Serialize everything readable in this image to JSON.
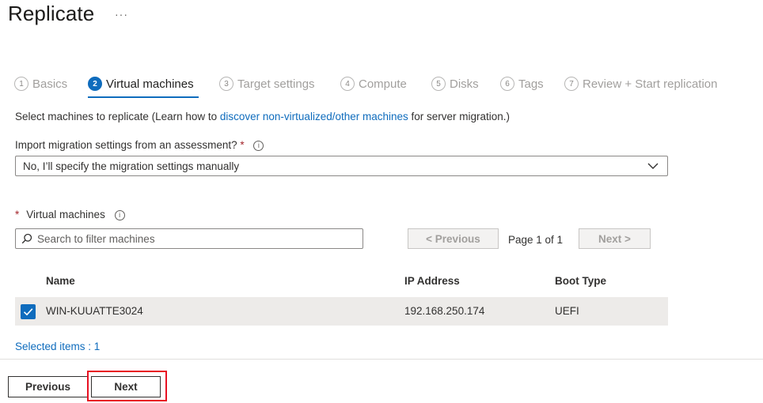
{
  "header": {
    "title": "Replicate",
    "more_label": "···"
  },
  "steps": [
    {
      "num": "1",
      "label": "Basics",
      "active": false
    },
    {
      "num": "2",
      "label": "Virtual machines",
      "active": true
    },
    {
      "num": "3",
      "label": "Target settings",
      "active": false
    },
    {
      "num": "4",
      "label": "Compute",
      "active": false
    },
    {
      "num": "5",
      "label": "Disks",
      "active": false
    },
    {
      "num": "6",
      "label": "Tags",
      "active": false
    },
    {
      "num": "7",
      "label": "Review + Start replication",
      "active": false
    }
  ],
  "intro": {
    "prefix": "Select machines to replicate (Learn how to ",
    "link": "discover non-virtualized/other machines",
    "suffix": " for server migration.)"
  },
  "import_settings": {
    "label": "Import migration settings from an assessment?",
    "required_mark": "*",
    "info": "i",
    "selected_value": "No, I’ll specify the migration settings manually"
  },
  "virtual_machines": {
    "required_mark": "*",
    "label": "Virtual machines",
    "info": "i",
    "search_placeholder": "Search to filter machines"
  },
  "pager": {
    "previous_label": "< Previous",
    "page_text": "Page 1 of 1",
    "next_label": "Next >"
  },
  "table": {
    "headers": {
      "name": "Name",
      "ip": "IP Address",
      "boot": "Boot Type"
    },
    "rows": [
      {
        "name": "WIN-KUUATTE3024",
        "ip": "192.168.250.174",
        "boot": "UEFI",
        "checked": true
      }
    ]
  },
  "selected_items": "Selected items : 1",
  "footer": {
    "previous_label": "Previous",
    "next_label": "Next"
  },
  "colors": {
    "accent": "#0f6cbd",
    "required": "#a4262c",
    "highlight": "#e81123",
    "row_bg": "#edebe9"
  },
  "icons": {
    "search": "search-icon",
    "chevron": "chevron-down-icon",
    "check": "checkmark-icon",
    "info": "info-icon"
  }
}
